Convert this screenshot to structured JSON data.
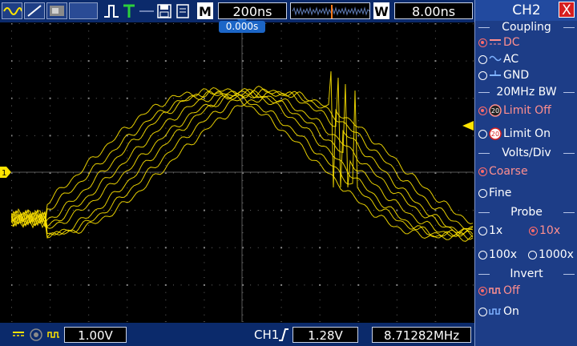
{
  "topbar": {
    "mode_label": "M",
    "timebase": "200ns",
    "window_label": "W",
    "window_value": "8.00ns",
    "trigger_time": "0.000s"
  },
  "bottombar": {
    "ch1_scale": "1.00V",
    "trigger_source": "CH1",
    "trigger_level": "1.28V",
    "frequency": "8.71282MHz"
  },
  "panel": {
    "title": "CH2",
    "close_label": "X",
    "coupling": {
      "header": "Coupling",
      "options": [
        {
          "label": "DC",
          "selected": true
        },
        {
          "label": "AC",
          "selected": false
        },
        {
          "label": "GND",
          "selected": false
        }
      ]
    },
    "bandwidth": {
      "header": "20MHz BW",
      "options": [
        {
          "label": "Limit Off",
          "selected": true
        },
        {
          "label": "Limit On",
          "selected": false
        }
      ]
    },
    "volts_div": {
      "header": "Volts/Div",
      "options": [
        {
          "label": "Coarse",
          "selected": true
        },
        {
          "label": "Fine",
          "selected": false
        }
      ]
    },
    "probe": {
      "header": "Probe",
      "options": [
        {
          "label": "1x",
          "selected": false
        },
        {
          "label": "10x",
          "selected": true
        },
        {
          "label": "100x",
          "selected": false
        },
        {
          "label": "1000x",
          "selected": false
        }
      ]
    },
    "invert": {
      "header": "Invert",
      "options": [
        {
          "label": "Off",
          "selected": true
        },
        {
          "label": "On",
          "selected": false
        }
      ]
    }
  },
  "markers": {
    "channel1_marker": "1"
  },
  "colors": {
    "trace": "#ffe400",
    "panel_bg": "#1d3d87",
    "bar_bg": "#0b2a6b",
    "selected": "#ff6b6b",
    "tag_bg": "#1c66c7"
  }
}
